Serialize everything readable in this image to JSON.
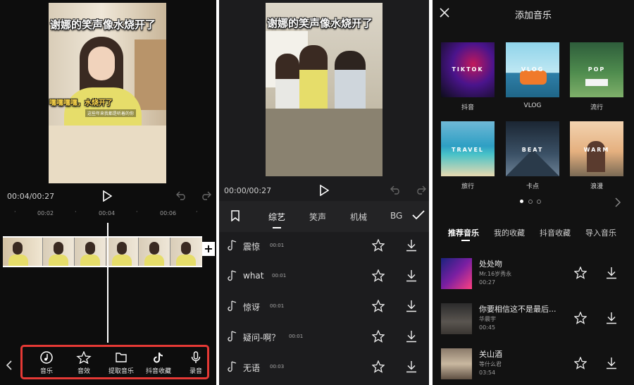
{
  "editor": {
    "video_caption": "谢娜的笑声像水烧开了",
    "subtitle": "嘿嘿嘿嘿，水烧开了",
    "subtitle_small": "这些年来我都是听着的你",
    "time_display": "00:04/00:27",
    "ticks": [
      "00:02",
      "00:04",
      "00:06"
    ],
    "toolbar": [
      {
        "label": "音乐",
        "icon": "music-disc-icon"
      },
      {
        "label": "音效",
        "icon": "star-music-icon"
      },
      {
        "label": "提取音乐",
        "icon": "folder-icon"
      },
      {
        "label": "抖音收藏",
        "icon": "tiktok-icon"
      },
      {
        "label": "录音",
        "icon": "microphone-icon"
      }
    ],
    "highlight_color": "#e53935"
  },
  "effects": {
    "video_caption": "谢娜的笑声像水烧开了",
    "time_display": "00:00/00:27",
    "tabs": [
      "综艺",
      "笑声",
      "机械",
      "BGI"
    ],
    "active_tab": "综艺",
    "sounds": [
      {
        "name": "震惊",
        "duration": "00:01"
      },
      {
        "name": "what",
        "duration": "00:01"
      },
      {
        "name": "惊讶",
        "duration": "00:01"
      },
      {
        "name": "疑问-啊？",
        "duration": "00:01"
      },
      {
        "name": "无语",
        "duration": "00:03"
      }
    ]
  },
  "music": {
    "title": "添加音乐",
    "categories": [
      {
        "label": "抖音",
        "cover_text": "TIKTOK"
      },
      {
        "label": "VLOG",
        "cover_text": "VLOG"
      },
      {
        "label": "流行",
        "cover_text": "POP"
      },
      {
        "label": "旅行",
        "cover_text": "TRAVEL"
      },
      {
        "label": "卡点",
        "cover_text": "BEAT"
      },
      {
        "label": "浪漫",
        "cover_text": "WARM"
      }
    ],
    "tabs": [
      "推荐音乐",
      "我的收藏",
      "抖音收藏",
      "导入音乐"
    ],
    "active_tab": "推荐音乐",
    "songs": [
      {
        "title": "处处吻",
        "artist": "Mr.16岁秀永",
        "duration": "00:27"
      },
      {
        "title": "你要相信这不是最后...",
        "artist": "华晨宇",
        "duration": "00:45"
      },
      {
        "title": "关山酒",
        "artist": "等什么君",
        "duration": "03:54"
      }
    ]
  }
}
